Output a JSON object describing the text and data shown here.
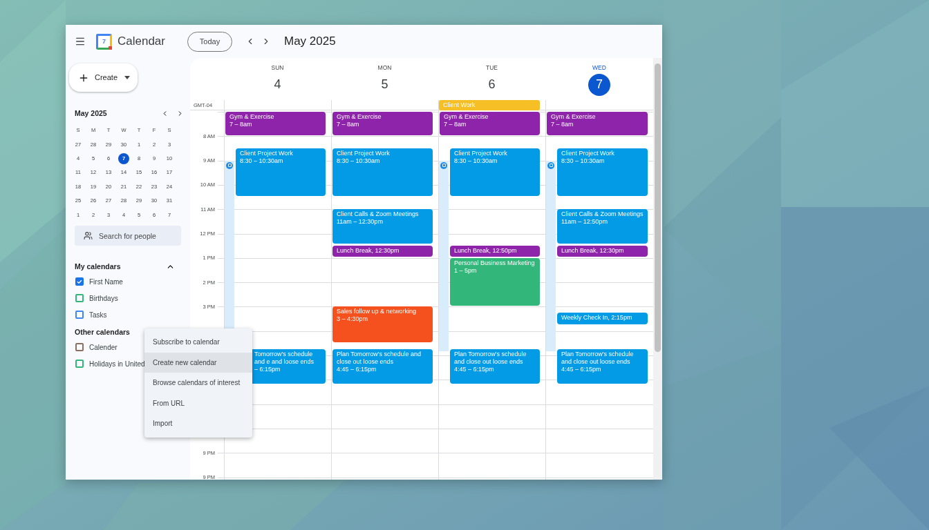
{
  "app": {
    "name": "Calendar",
    "logo_day": "7"
  },
  "toolbar": {
    "today_button": "Today",
    "period": "May 2025"
  },
  "create_button": "Create",
  "mini_calendar": {
    "title": "May 2025",
    "weekdays": [
      "S",
      "M",
      "T",
      "W",
      "T",
      "F",
      "S"
    ],
    "weeks": [
      [
        {
          "day": "27",
          "selected": false
        },
        {
          "day": "28",
          "selected": false
        },
        {
          "day": "29",
          "selected": false
        },
        {
          "day": "30",
          "selected": false
        },
        {
          "day": "1",
          "selected": false
        },
        {
          "day": "2",
          "selected": false
        },
        {
          "day": "3",
          "selected": false
        }
      ],
      [
        {
          "day": "4",
          "selected": false
        },
        {
          "day": "5",
          "selected": false
        },
        {
          "day": "6",
          "selected": false
        },
        {
          "day": "7",
          "selected": true
        },
        {
          "day": "8",
          "selected": false
        },
        {
          "day": "9",
          "selected": false
        },
        {
          "day": "10",
          "selected": false
        }
      ],
      [
        {
          "day": "11",
          "selected": false
        },
        {
          "day": "12",
          "selected": false
        },
        {
          "day": "13",
          "selected": false
        },
        {
          "day": "14",
          "selected": false
        },
        {
          "day": "15",
          "selected": false
        },
        {
          "day": "16",
          "selected": false
        },
        {
          "day": "17",
          "selected": false
        }
      ],
      [
        {
          "day": "18",
          "selected": false
        },
        {
          "day": "19",
          "selected": false
        },
        {
          "day": "20",
          "selected": false
        },
        {
          "day": "21",
          "selected": false
        },
        {
          "day": "22",
          "selected": false
        },
        {
          "day": "23",
          "selected": false
        },
        {
          "day": "24",
          "selected": false
        }
      ],
      [
        {
          "day": "25",
          "selected": false
        },
        {
          "day": "26",
          "selected": false
        },
        {
          "day": "27",
          "selected": false
        },
        {
          "day": "28",
          "selected": false
        },
        {
          "day": "29",
          "selected": false
        },
        {
          "day": "30",
          "selected": false
        },
        {
          "day": "31",
          "selected": false
        }
      ],
      [
        {
          "day": "1",
          "selected": false
        },
        {
          "day": "2",
          "selected": false
        },
        {
          "day": "3",
          "selected": false
        },
        {
          "day": "4",
          "selected": false
        },
        {
          "day": "5",
          "selected": false
        },
        {
          "day": "6",
          "selected": false
        },
        {
          "day": "7",
          "selected": false
        }
      ]
    ]
  },
  "search": {
    "placeholder": "Search for people"
  },
  "my_calendars": {
    "title": "My calendars",
    "expanded": true,
    "items": [
      {
        "label": "First Name",
        "checked": true,
        "color": "#1a73e8"
      },
      {
        "label": "Birthdays",
        "checked": false,
        "color": "#33b679"
      },
      {
        "label": "Tasks",
        "checked": false,
        "color": "#4285f4"
      }
    ]
  },
  "other_calendars": {
    "title": "Other calendars",
    "items": [
      {
        "label": "Calender",
        "checked": false,
        "color": "#8d6e63"
      },
      {
        "label": "Holidays in United",
        "checked": false,
        "color": "#33b679"
      }
    ]
  },
  "menu": {
    "items": [
      {
        "label": "Subscribe to calendar",
        "selected": false
      },
      {
        "label": "Create new calendar",
        "selected": true
      },
      {
        "label": "Browse calendars of interest",
        "selected": false
      },
      {
        "label": "From URL",
        "selected": false
      },
      {
        "label": "Import",
        "selected": false
      }
    ]
  },
  "timezone": "GMT-04",
  "time_labels": [
    "8 AM",
    "9 AM",
    "10 AM",
    "11 AM",
    "12 PM",
    "1 PM",
    "2 PM",
    "3 PM",
    "9 PM",
    "9 PM"
  ],
  "days": [
    {
      "name": "SUN",
      "date": "4",
      "today": false,
      "working_location": true,
      "events": [
        {
          "title": "Gym & Exercise",
          "time": "7 – 8am",
          "color": "#8e24aa",
          "obscured": false
        },
        {
          "title": "Client Project Work",
          "time": "8:30 – 10:30am",
          "color": "#039be5",
          "obscured": false
        },
        {
          "title": "Tomorrow's schedule and e and loose ends",
          "time": "– 6:15pm",
          "color": "#039be5",
          "obscured": true
        }
      ]
    },
    {
      "name": "MON",
      "date": "5",
      "today": false,
      "working_location": false,
      "events": [
        {
          "title": "Gym & Exercise",
          "time": "7 – 8am",
          "color": "#8e24aa",
          "obscured": false
        },
        {
          "title": "Client Project Work",
          "time": "8:30 – 10:30am",
          "color": "#039be5",
          "obscured": false
        },
        {
          "title": "Client Calls & Zoom Meetings",
          "time": "11am – 12:30pm",
          "color": "#039be5",
          "obscured": false
        },
        {
          "title": "Lunch Break, 12:30pm",
          "color": "#8e24aa",
          "obscured": false
        },
        {
          "title": "Sales follow up & networking",
          "time": "3 – 4:30pm",
          "color": "#f4511e",
          "obscured": false
        },
        {
          "title": "Plan Tomorrow's schedule and close out loose ends",
          "time": "4:45 – 6:15pm",
          "color": "#039be5",
          "obscured": false
        }
      ]
    },
    {
      "name": "TUE",
      "date": "6",
      "today": false,
      "working_location": true,
      "all_day": [
        {
          "title": "Client Work",
          "color": "#f6bf26"
        }
      ],
      "events": [
        {
          "title": "Gym & Exercise",
          "time": "7 – 8am",
          "color": "#8e24aa",
          "obscured": false
        },
        {
          "title": "Client Project Work",
          "time": "8:30 – 10:30am",
          "color": "#039be5",
          "obscured": false
        },
        {
          "title": "Lunch Break, 12:50pm",
          "color": "#8e24aa",
          "obscured": false
        },
        {
          "title": "Personal Business Marketing",
          "time": "1 – 5pm",
          "color": "#33b679",
          "obscured": false
        },
        {
          "title": "Plan Tomorrow's schedule and close out loose ends",
          "time": "4:45 – 6:15pm",
          "color": "#039be5",
          "obscured": false
        }
      ]
    },
    {
      "name": "WED",
      "date": "7",
      "today": true,
      "working_location": true,
      "events": [
        {
          "title": "Gym & Exercise",
          "time": "7 – 8am",
          "color": "#8e24aa",
          "obscured": false
        },
        {
          "title": "Client Project Work",
          "time": "8:30 – 10:30am",
          "color": "#039be5",
          "obscured": false
        },
        {
          "title": "Client Calls & Zoom Meetings",
          "time": "11am – 12:50pm",
          "color": "#039be5",
          "obscured": false
        },
        {
          "title": "Lunch Break, 12:30pm",
          "color": "#8e24aa",
          "obscured": false
        },
        {
          "title": "Weekly Check In, 2:15pm",
          "color": "#039be5",
          "obscured": false
        },
        {
          "title": "Plan Tomorrow's schedule and close out loose ends",
          "time": "4:45 – 6:15pm",
          "color": "#039be5",
          "obscured": false
        }
      ]
    }
  ]
}
